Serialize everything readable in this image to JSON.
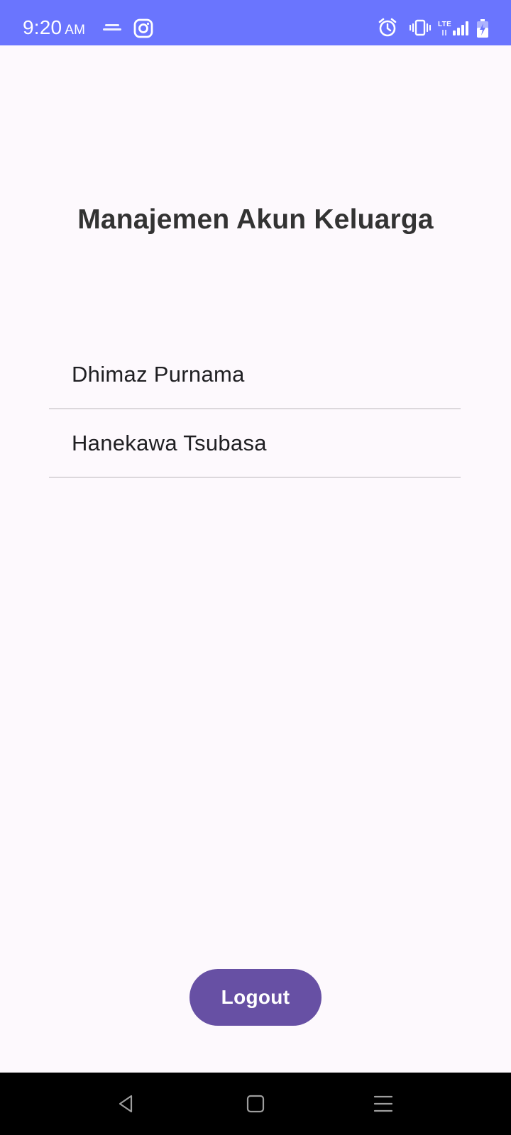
{
  "status_bar": {
    "time": "9:20",
    "ampm": "AM",
    "background_color": "#6a75fe",
    "network_label": "LTE",
    "icons": [
      "weather-icon",
      "instagram-icon",
      "alarm-icon",
      "vibrate-icon",
      "signal-icon",
      "battery-charging-icon"
    ]
  },
  "page": {
    "title": "Manajemen Akun Keluarga"
  },
  "members": [
    {
      "name": "Dhimaz Purnama"
    },
    {
      "name": "Hanekawa Tsubasa"
    }
  ],
  "actions": {
    "logout_label": "Logout",
    "accent_color": "#6750a4"
  },
  "nav_bar": {
    "icons": [
      "back-icon",
      "home-icon",
      "menu-icon"
    ]
  }
}
